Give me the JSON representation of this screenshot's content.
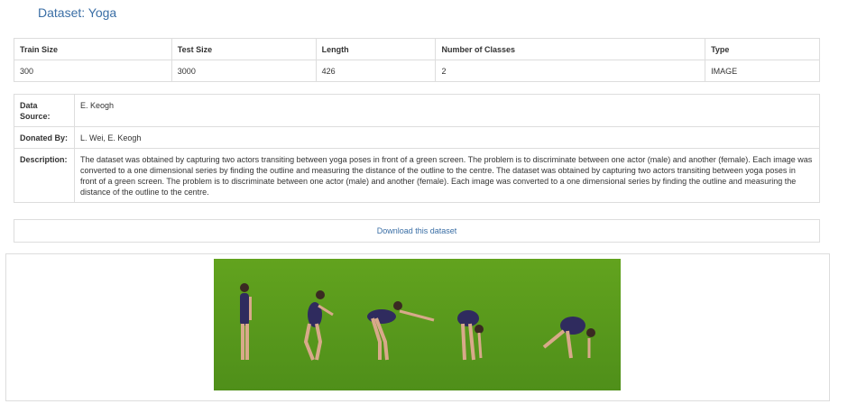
{
  "page": {
    "title": "Dataset: Yoga"
  },
  "summary": {
    "headers": [
      "Train Size",
      "Test Size",
      "Length",
      "Number of Classes",
      "Type"
    ],
    "values": [
      "300",
      "3000",
      "426",
      "2",
      "IMAGE"
    ]
  },
  "details": {
    "source_label": "Data Source:",
    "source_value": "E. Keogh",
    "donated_label": "Donated By:",
    "donated_value": "L. Wei, E. Keogh",
    "description_label": "Description:",
    "description_value": "The dataset was obtained by capturing two actors transiting between yoga poses in front of a green screen. The problem is to discriminate between one actor (male) and another (female). Each image was converted to a one dimensional series by finding the outline and measuring the distance of the outline to the centre. The dataset was obtained by capturing two actors transiting between yoga poses in front of a green screen. The problem is to discriminate between one actor (male) and another (female). Each image was converted to a one dimensional series by finding the outline and measuring the distance of the outline to the centre."
  },
  "download": {
    "label": "Download this dataset"
  },
  "colors": {
    "accent": "#3a6ea5",
    "border": "#dddddd",
    "green_screen": "#5e9e1f",
    "leotard": "#3a2f6e"
  }
}
